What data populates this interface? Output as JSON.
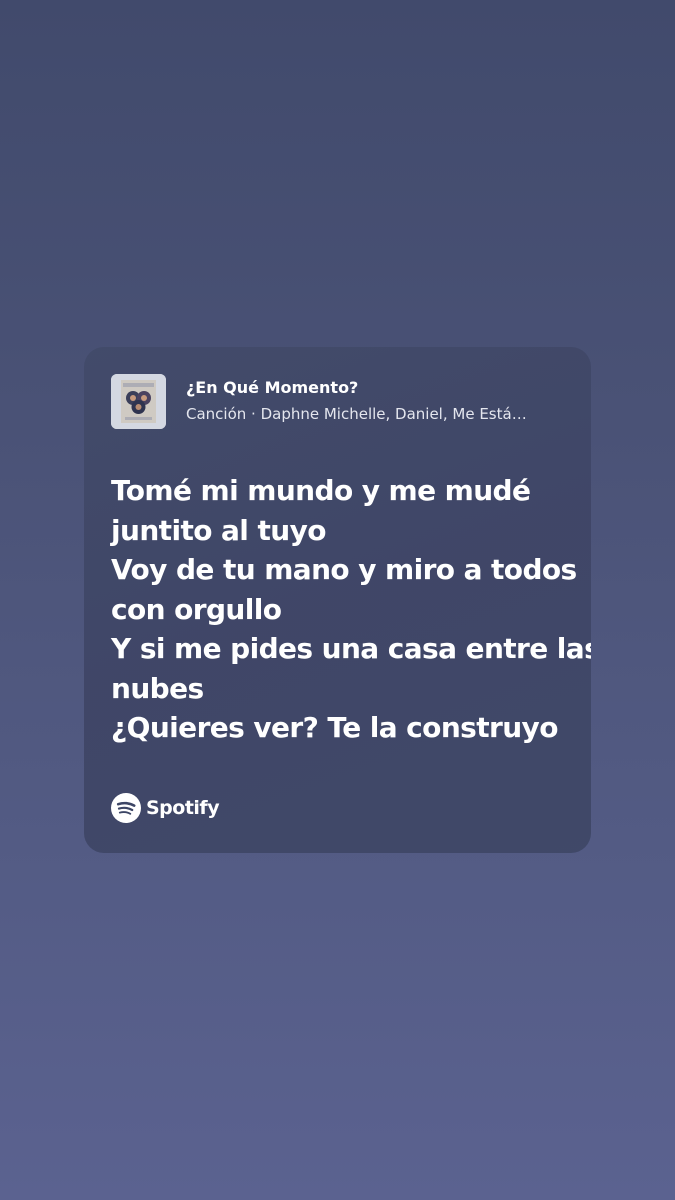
{
  "card": {
    "song_title": "¿En Qué Momento?",
    "song_subtitle": "Canción · Daphne Michelle, Daniel, Me Está…",
    "lyrics": [
      "Tomé mi mundo y me mudé",
      "juntito al tuyo",
      "Voy de tu mano y miro a todos",
      "con orgullo",
      "Y si me pides una casa entre las",
      "nubes",
      "¿Quieres ver? Te la construyo"
    ],
    "brand": {
      "icon": "spotify-logo-icon",
      "name": "Spotify"
    },
    "cover_icon": "album-cover-image"
  },
  "colors": {
    "background_top": "#414a6c",
    "background_bottom": "#5b6290",
    "card": "#3c4565",
    "text": "#ffffff"
  }
}
